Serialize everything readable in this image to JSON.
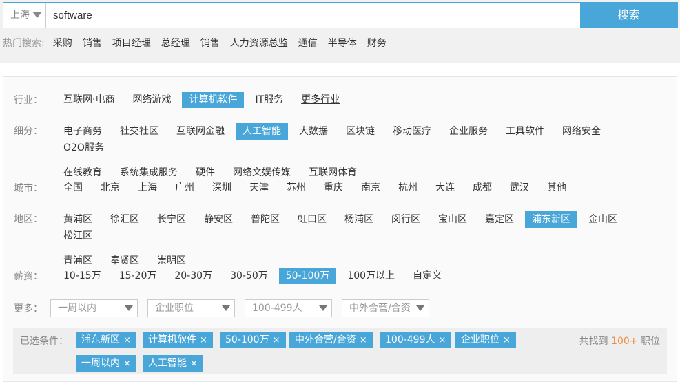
{
  "search": {
    "city": "上海",
    "query": "software",
    "button_label": "搜索"
  },
  "hot_search": {
    "label": "热门搜索:",
    "items": [
      "采购",
      "销售",
      "项目经理",
      "总经理",
      "销售",
      "人力资源总监",
      "通信",
      "半导体",
      "财务"
    ]
  },
  "filters": {
    "industry": {
      "label": "行业：",
      "options": [
        "互联网·电商",
        "网络游戏",
        "计算机软件",
        "IT服务",
        "更多行业"
      ],
      "selected": "计算机软件"
    },
    "subcategory": {
      "label": "细分：",
      "options_row1": [
        "电子商务",
        "社交社区",
        "互联网金融",
        "人工智能",
        "大数据",
        "区块链",
        "移动医疗",
        "企业服务",
        "工具软件",
        "网络安全",
        "O2O服务"
      ],
      "options_row2": [
        "在线教育",
        "系统集成服务",
        "硬件",
        "网络文娱传媒",
        "互联网体育"
      ],
      "selected": "人工智能"
    },
    "city": {
      "label": "城市：",
      "options": [
        "全国",
        "北京",
        "上海",
        "广州",
        "深圳",
        "天津",
        "苏州",
        "重庆",
        "南京",
        "杭州",
        "大连",
        "成都",
        "武汉",
        "其他"
      ]
    },
    "district": {
      "label": "地区：",
      "options_row1": [
        "黄浦区",
        "徐汇区",
        "长宁区",
        "静安区",
        "普陀区",
        "虹口区",
        "杨浦区",
        "闵行区",
        "宝山区",
        "嘉定区",
        "浦东新区",
        "金山区",
        "松江区"
      ],
      "options_row2": [
        "青浦区",
        "奉贤区",
        "崇明区"
      ],
      "selected": "浦东新区"
    },
    "salary": {
      "label": "薪资：",
      "options": [
        "10-15万",
        "15-20万",
        "20-30万",
        "30-50万",
        "50-100万",
        "100万以上",
        "自定义"
      ],
      "selected": "50-100万"
    },
    "more": {
      "label": "更多：",
      "dropdowns": [
        "一周以内",
        "企业职位",
        "100-499人",
        "中外合营/合资"
      ]
    }
  },
  "selected_conditions": {
    "label": "已选条件：",
    "tags": [
      "浦东新区",
      "计算机软件",
      "50-100万",
      "中外合营/合资",
      "100-499人",
      "企业职位",
      "一周以内",
      "人工智能"
    ],
    "remove_glyph": "×",
    "result_prefix": "共找到",
    "result_count": "100+",
    "result_suffix": "职位"
  },
  "colors": {
    "accent": "#48a6d9",
    "highlight": "#f08c3c",
    "label_gray": "#888888"
  },
  "icons": {
    "city_dropdown": "triangle-down-icon",
    "select_dropdown": "triangle-down-icon",
    "tag_remove": "close-icon"
  }
}
